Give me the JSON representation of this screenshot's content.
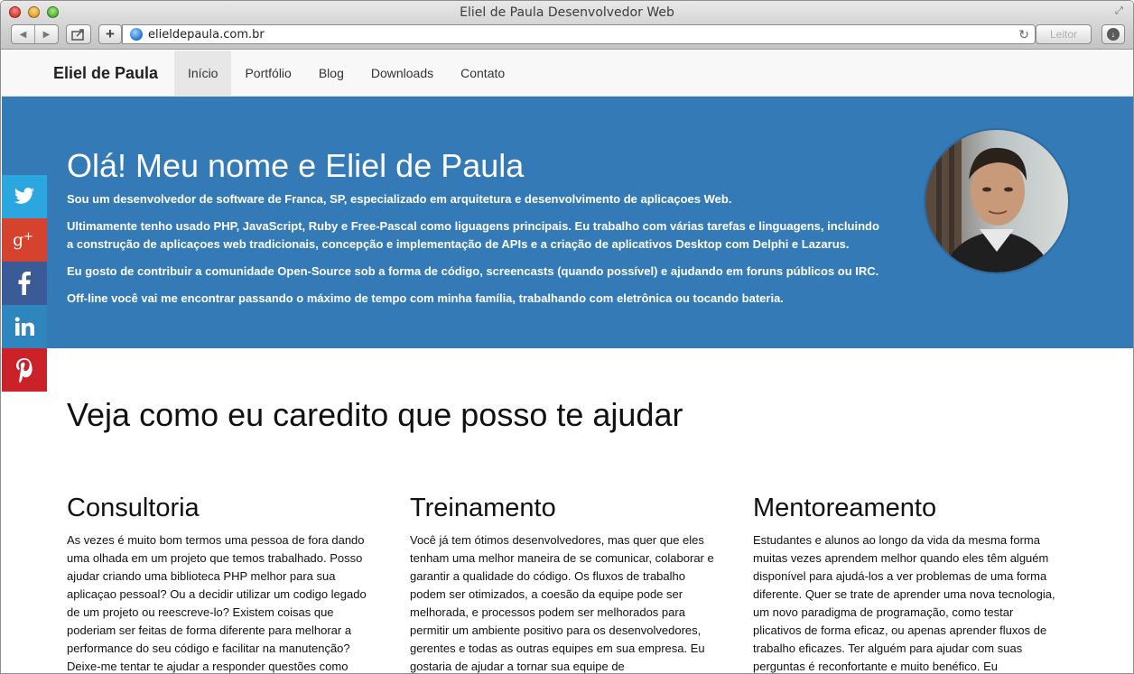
{
  "window": {
    "title": "Eliel de Paula Desenvolvedor Web",
    "url": "elieldepaula.com.br",
    "reader_label": "Leitor"
  },
  "navbar": {
    "brand": "Eliel de Paula",
    "items": [
      {
        "label": "Início",
        "active": true
      },
      {
        "label": "Portfólio"
      },
      {
        "label": "Blog"
      },
      {
        "label": "Downloads"
      },
      {
        "label": "Contato"
      }
    ]
  },
  "hero": {
    "title": "Olá! Meu nome e Eliel de Paula",
    "p1": "Sou um desenvolvedor de software de Franca, SP, especializado em arquitetura e desenvolvimento de aplicaçoes Web.",
    "p2": "Ultimamente tenho usado PHP, JavaScript, Ruby e Free-Pascal como liguagens principais. Eu trabalho com várias tarefas e linguagens, incluindo a construção de aplicaçoes web tradicionais, concepção e implementação de APIs e a criação de aplicativos Desktop com Delphi e Lazarus.",
    "p3": "Eu gosto de contribuir a comunidade Open-Source sob a forma de código, screencasts (quando possível) e ajudando em foruns públicos ou IRC.",
    "p4": "Off-line você vai me encontrar passando o máximo de tempo com minha família, trabalhando com eletrônica ou tocando bateria."
  },
  "social": [
    {
      "name": "twitter",
      "color": "#2ba6df"
    },
    {
      "name": "google-plus",
      "color": "#d5432f"
    },
    {
      "name": "facebook",
      "color": "#3a5a98"
    },
    {
      "name": "linkedin",
      "color": "#2f86bf"
    },
    {
      "name": "pinterest",
      "color": "#cb2128"
    }
  ],
  "colors": {
    "hero_bg": "#337ab7",
    "navbar_bg": "#f8f8f8",
    "nav_active_bg": "#e7e7e7"
  },
  "main": {
    "section_title": "Veja como eu caredito que posso te ajudar",
    "columns": [
      {
        "title": "Consultoria",
        "text": "As vezes é muito bom termos uma pessoa de fora dando uma olhada em um projeto que temos trabalhado. Posso ajudar criando uma biblioteca PHP melhor para sua aplicaçao pessoal? Ou a decidir utilizar um codigo legado de um projeto ou reescreve-lo? Existem coisas que poderiam ser feitas de forma diferente para melhorar a performance do seu código e facilitar na manutenção? Deixe-me tentar te ajudar a responder questões como"
      },
      {
        "title": "Treinamento",
        "text": "Você já tem ótimos desenvolvedores, mas quer que eles tenham uma melhor maneira de se comunicar, colaborar e garantir a qualidade do código. Os fluxos de trabalho podem ser otimizados, a coesão da equipe pode ser melhorada, e processos podem ser melhorados para permitir um ambiente positivo para os desenvolvedores, gerentes e todas as outras equipes em sua empresa. Eu gostaria de ajudar a tornar sua equipe de"
      },
      {
        "title": "Mentoreamento",
        "text": "Estudantes e alunos ao longo da vida da mesma forma muitas vezes aprendem melhor quando eles têm alguém disponível para ajudá-los a ver problemas de uma forma diferente. Quer se trate de aprender uma nova tecnologia, um novo paradigma de programação, como testar plicativos de forma eficaz, ou apenas aprender fluxos de trabalho eficazes. Ter alguém para ajudar com suas perguntas é reconfortante e muito benéfico. Eu"
      }
    ]
  }
}
